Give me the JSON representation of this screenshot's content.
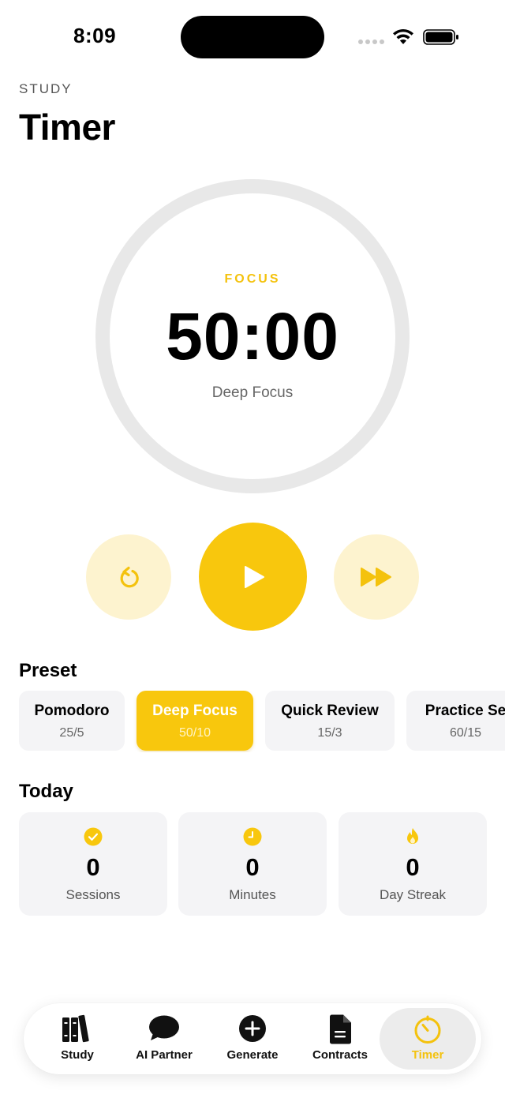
{
  "status_bar": {
    "time": "8:09"
  },
  "header": {
    "eyebrow": "STUDY",
    "title": "Timer"
  },
  "timer": {
    "phase": "FOCUS",
    "time": "50:00",
    "preset_name": "Deep Focus"
  },
  "colors": {
    "accent": "#f8c70d",
    "accent_text": "#f4c20d",
    "accent_soft": "#fdf3cf",
    "card_bg": "#f4f4f6"
  },
  "presets": {
    "title": "Preset",
    "items": [
      {
        "name": "Pomodoro",
        "value": "25/5",
        "selected": false
      },
      {
        "name": "Deep Focus",
        "value": "50/10",
        "selected": true
      },
      {
        "name": "Quick Review",
        "value": "15/3",
        "selected": false
      },
      {
        "name": "Practice Se",
        "value": "60/15",
        "selected": false
      }
    ]
  },
  "today": {
    "title": "Today",
    "stats": [
      {
        "icon": "checkmark-circle-icon",
        "value": "0",
        "label": "Sessions"
      },
      {
        "icon": "clock-icon",
        "value": "0",
        "label": "Minutes"
      },
      {
        "icon": "flame-icon",
        "value": "0",
        "label": "Day Streak"
      }
    ]
  },
  "tabs": [
    {
      "icon": "books-icon",
      "label": "Study",
      "active": false
    },
    {
      "icon": "chat-bubble-icon",
      "label": "AI Partner",
      "active": false
    },
    {
      "icon": "plus-circle-icon",
      "label": "Generate",
      "active": false
    },
    {
      "icon": "document-icon",
      "label": "Contracts",
      "active": false
    },
    {
      "icon": "timer-icon",
      "label": "Timer",
      "active": true
    }
  ]
}
